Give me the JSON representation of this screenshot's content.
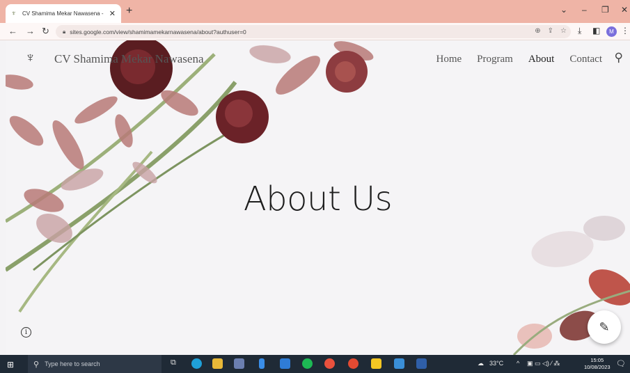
{
  "browser": {
    "tab_title": "CV Shamima Mekar Nawasena -",
    "tab_close": "✕",
    "new_tab": "+",
    "url": "sites.google.com/view/shamimamekarnawasena/about?authuser=0",
    "profile_initial": "M"
  },
  "site": {
    "title": "CV Shamima Mekar Nawasena",
    "nav": [
      "Home",
      "Program",
      "About",
      "Contact"
    ],
    "active_nav": "About",
    "hero_title": "About Us"
  },
  "taskbar": {
    "search_placeholder": "Type here to search",
    "weather": "33°C",
    "time": "15:05",
    "date": "10/08/2023"
  },
  "icons": {
    "back": "back-arrow-icon",
    "forward": "forward-arrow-icon",
    "reload": "reload-icon",
    "search": "search-icon",
    "info": "info-icon",
    "edit": "pencil-icon"
  },
  "colors": {
    "tab_strip": "#efb4a6",
    "taskbar": "#1f2a36",
    "profile": "#7a6fdc"
  }
}
